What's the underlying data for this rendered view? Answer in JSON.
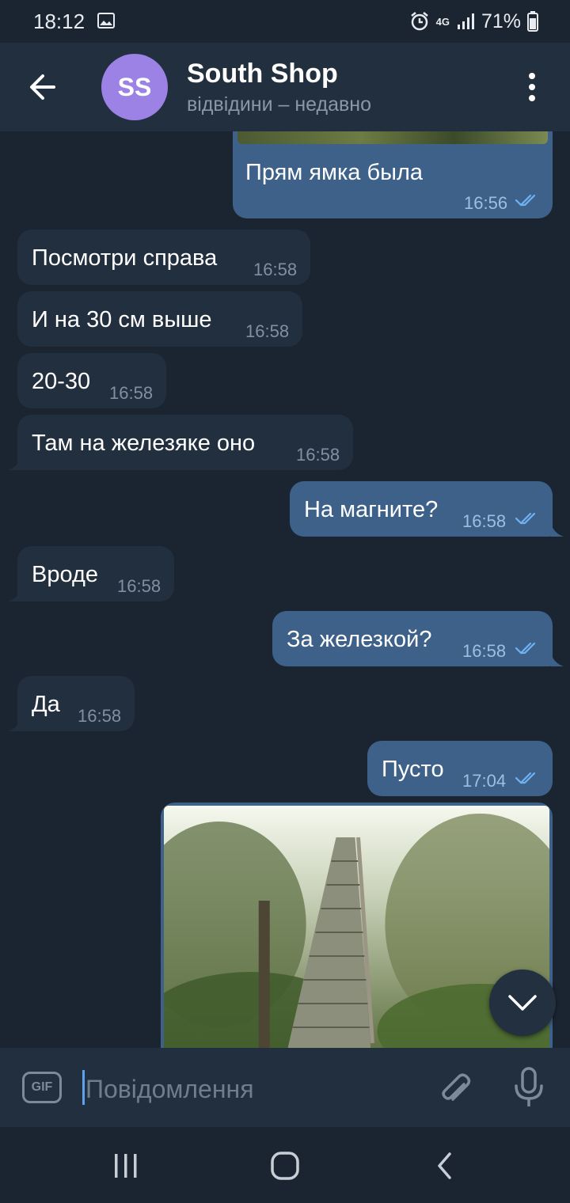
{
  "status_bar": {
    "time": "18:12",
    "network": "4G",
    "battery": "71%"
  },
  "header": {
    "avatar_initials": "SS",
    "title": "South Shop",
    "subtitle": "відвідини – недавно"
  },
  "messages": [
    {
      "side": "out",
      "text": "Прям ямка была",
      "time": "16:56",
      "read": true
    },
    {
      "side": "in",
      "text": "Посмотри справа",
      "time": "16:58"
    },
    {
      "side": "in",
      "text": "И на 30 см выше",
      "time": "16:58"
    },
    {
      "side": "in",
      "text": "20-30",
      "time": "16:58"
    },
    {
      "side": "in",
      "text": "Там на железяке оно",
      "time": "16:58"
    },
    {
      "side": "out",
      "text": "На магните?",
      "time": "16:58",
      "read": true
    },
    {
      "side": "in",
      "text": "Вроде",
      "time": "16:58"
    },
    {
      "side": "out",
      "text": "За железкой?",
      "time": "16:58",
      "read": true
    },
    {
      "side": "in",
      "text": "Да",
      "time": "16:58"
    },
    {
      "side": "out",
      "text": "Пусто",
      "time": "17:04",
      "read": true
    }
  ],
  "composer": {
    "placeholder": "Повідомлення",
    "gif_label": "GIF"
  },
  "icons": {
    "back": "arrow-left-icon",
    "menu": "more-vertical-icon",
    "scroll_down": "chevron-down-icon",
    "attach": "paperclip-icon",
    "mic": "microphone-icon",
    "nav_recents": "recents-icon",
    "nav_home": "home-icon",
    "nav_back": "nav-back-icon"
  },
  "colors": {
    "background": "#1b2431",
    "header": "#222f3e",
    "incoming_bubble": "#222f3e",
    "outgoing_bubble": "#3e6189",
    "avatar": "#9d82e5",
    "read_check": "#6fb2f2"
  }
}
